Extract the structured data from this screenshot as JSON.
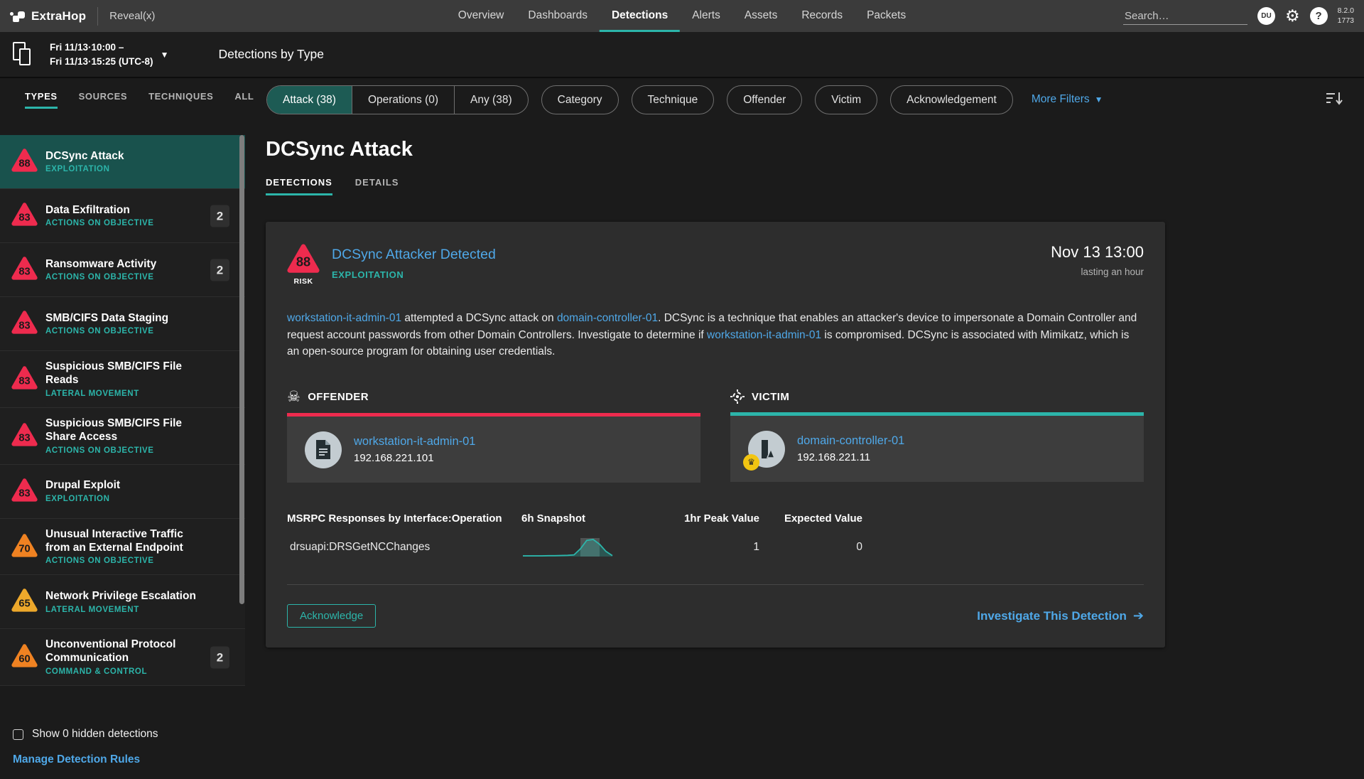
{
  "colors": {
    "accent_teal": "#2cb5aa",
    "link_blue": "#4fa8e8",
    "risk_red": "#ee2b4e",
    "risk_orange": "#ef8222",
    "risk_yellow": "#eda82b",
    "offender_accent": "#ee2b4e",
    "victim_accent": "#2cb5aa"
  },
  "top_nav": {
    "brand": "ExtraHop",
    "product": "Reveal(x)",
    "items": [
      {
        "label": "Overview",
        "active": false
      },
      {
        "label": "Dashboards",
        "active": false
      },
      {
        "label": "Detections",
        "active": true
      },
      {
        "label": "Alerts",
        "active": false
      },
      {
        "label": "Assets",
        "active": false
      },
      {
        "label": "Records",
        "active": false
      },
      {
        "label": "Packets",
        "active": false
      }
    ],
    "search_placeholder": "Search…",
    "avatar_initials": "DU",
    "help_glyph": "?",
    "version_line1": "8.2.0",
    "version_line2": "1773"
  },
  "sub_header": {
    "time_range_line1": "Fri 11/13·10:00 –",
    "time_range_line2": "Fri 11/13·15:25 (UTC-8)",
    "page_title": "Detections by Type"
  },
  "filter_bar": {
    "tabs": [
      {
        "label": "TYPES",
        "active": true
      },
      {
        "label": "SOURCES",
        "active": false
      },
      {
        "label": "TECHNIQUES",
        "active": false
      },
      {
        "label": "ALL",
        "active": false
      }
    ],
    "segments": [
      {
        "label": "Attack (38)",
        "active": true
      },
      {
        "label": "Operations (0)",
        "active": false
      },
      {
        "label": "Any (38)",
        "active": false
      }
    ],
    "filters": [
      "Category",
      "Technique",
      "Offender",
      "Victim",
      "Acknowledgement"
    ],
    "more_filters_label": "More Filters"
  },
  "sidebar": {
    "items": [
      {
        "risk": 88,
        "color": "#ee2b4e",
        "title": "DCSync Attack",
        "category": "EXPLOITATION",
        "count": null,
        "selected": true
      },
      {
        "risk": 83,
        "color": "#ee2b4e",
        "title": "Data Exfiltration",
        "category": "ACTIONS ON OBJECTIVE",
        "count": 2,
        "selected": false
      },
      {
        "risk": 83,
        "color": "#ee2b4e",
        "title": "Ransomware Activity",
        "category": "ACTIONS ON OBJECTIVE",
        "count": 2,
        "selected": false
      },
      {
        "risk": 83,
        "color": "#ee2b4e",
        "title": "SMB/CIFS Data Staging",
        "category": "ACTIONS ON OBJECTIVE",
        "count": null,
        "selected": false
      },
      {
        "risk": 83,
        "color": "#ee2b4e",
        "title": "Suspicious SMB/CIFS File Reads",
        "category": "LATERAL MOVEMENT",
        "count": null,
        "selected": false
      },
      {
        "risk": 83,
        "color": "#ee2b4e",
        "title": "Suspicious SMB/CIFS File Share Access",
        "category": "ACTIONS ON OBJECTIVE",
        "count": null,
        "selected": false
      },
      {
        "risk": 83,
        "color": "#ee2b4e",
        "title": "Drupal Exploit",
        "category": "EXPLOITATION",
        "count": null,
        "selected": false
      },
      {
        "risk": 70,
        "color": "#ef8222",
        "title": "Unusual Interactive Traffic from an External Endpoint",
        "category": "ACTIONS ON OBJECTIVE",
        "count": null,
        "selected": false
      },
      {
        "risk": 65,
        "color": "#eda82b",
        "title": "Network Privilege Escalation",
        "category": "LATERAL MOVEMENT",
        "count": null,
        "selected": false
      },
      {
        "risk": 60,
        "color": "#ef8222",
        "title": "Unconventional Protocol Communication",
        "category": "COMMAND & CONTROL",
        "count": 2,
        "selected": false
      }
    ],
    "show_hidden_label": "Show 0 hidden detections",
    "manage_rules_label": "Manage Detection Rules"
  },
  "main": {
    "title": "DCSync Attack",
    "tabs": [
      {
        "label": "DETECTIONS",
        "active": true
      },
      {
        "label": "DETAILS",
        "active": false
      }
    ],
    "card": {
      "risk": 88,
      "risk_color": "#ee2b4e",
      "risk_label": "RISK",
      "title": "DCSync Attacker Detected",
      "category": "EXPLOITATION",
      "time": "Nov 13 13:00",
      "duration": "lasting an hour",
      "description_parts": [
        {
          "text": "workstation-it-admin-01",
          "link": true
        },
        {
          "text": " attempted a DCSync attack on ",
          "link": false
        },
        {
          "text": "domain-controller-01",
          "link": true
        },
        {
          "text": ". DCSync is a technique that enables an attacker's device to impersonate a Domain Controller and request account passwords from other Domain Controllers. Investigate to determine if ",
          "link": false
        },
        {
          "text": "workstation-it-admin-01",
          "link": true
        },
        {
          "text": " is compromised. DCSync is associated with Mimikatz, which is an open-source program for obtaining user credentials.",
          "link": false
        }
      ],
      "offender": {
        "label": "OFFENDER",
        "name": "workstation-it-admin-01",
        "ip": "192.168.221.101"
      },
      "victim": {
        "label": "VICTIM",
        "name": "domain-controller-01",
        "ip": "192.168.221.11"
      },
      "metrics": {
        "columns": [
          "MSRPC Responses by Interface:Operation",
          "6h Snapshot",
          "1hr Peak Value",
          "Expected Value"
        ],
        "rows": [
          {
            "name": "drsuapi:DRSGetNCChanges",
            "peak_value": "1",
            "expected_value": "0",
            "sparkline": [
              0.04,
              0.04,
              0.04,
              0.04,
              0.05,
              0.05,
              0.06,
              0.07,
              0.1,
              0.45,
              0.95,
              1.0,
              0.72,
              0.3,
              0.05
            ]
          }
        ]
      },
      "acknowledge_label": "Acknowledge",
      "investigate_label": "Investigate This Detection"
    }
  }
}
